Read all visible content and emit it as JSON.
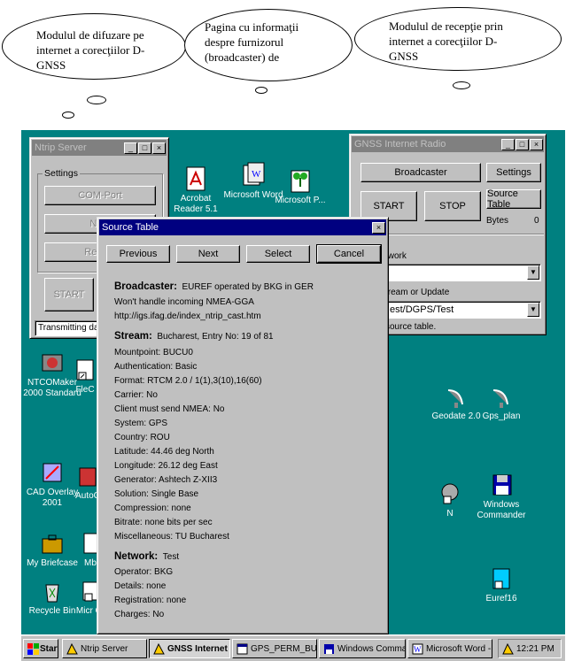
{
  "callouts": {
    "left": "Modulul de difuzare pe internet a corecţiilor D-GNSS",
    "middle": "Pagina cu informaţii despre furnizorul (broadcaster) de",
    "right": "Modulul de recepţie prin internet a corecţiilor D-GNSS"
  },
  "ntrip_server": {
    "title": "Ntrip Server",
    "settings_label": "Settings",
    "com_port": "COM-Port",
    "ntrip": "Ntrip",
    "record": "Record",
    "start": "START",
    "status": "Transmitting data"
  },
  "gnss_radio": {
    "title": "GNSS Internet Radio",
    "broadcaster": "Broadcaster",
    "settings": "Settings",
    "start": "START",
    "stop": "STOP",
    "source_table": "Source Table",
    "bytes_label": "Bytes",
    "bytes_value": "0",
    "network_label": "twork",
    "stream_label": "tream or Update",
    "stream_value": "est/DGPS/Test",
    "status": "source table."
  },
  "source_table": {
    "title": "Source Table",
    "buttons": {
      "previous": "Previous",
      "next": "Next",
      "select": "Select",
      "cancel": "Cancel"
    },
    "broadcaster_hdr": "Broadcaster:",
    "broadcaster_val": "EUREF operated by BKG in GER",
    "broadcaster_note": "Won't handle incoming NMEA-GGA",
    "broadcaster_url": "http://igs.ifag.de/index_ntrip_cast.htm",
    "stream_hdr": "Stream:",
    "stream_val": "Bucharest, Entry No: 19 of 81",
    "stream_rows": [
      "Mountpoint:  BUCU0",
      "Authentication: Basic",
      "Format:    RTCM 2.0 / 1(1),3(10),16(60)",
      "Carrier:    No",
      "Client must send NMEA:    No",
      "System:    GPS",
      "Country:    ROU",
      "Latitude:     44.46 deg North",
      "Longitude:    26.12 deg East",
      "Generator:    Ashtech Z-XII3",
      "Solution:    Single Base",
      "Compression:    none",
      "Bitrate:      none bits per sec",
      "Miscellaneous:    TU Bucharest"
    ],
    "network_hdr": "Network:",
    "network_val": "Test",
    "network_rows": [
      "Operator:  BKG",
      "Details:   none",
      "Registration:   none",
      "Charges:  No"
    ]
  },
  "desktop_icons": {
    "acrobat": "Acrobat Reader 5.1",
    "word": "Microsoft Word",
    "micro": "Microsoft P...",
    "ntcomaker": "NTCOMaker 2000 Standard",
    "flec": "FleC",
    "cad": "CAD Overlay 2001",
    "autoc": "AutoC",
    "briefcase": "My Briefcase",
    "mb": "Mb",
    "recycle": "Recycle Bin",
    "micro2": "Micr Of",
    "geodate": "Geodate 2.0",
    "gps_plan": "Gps_plan",
    "n": "N",
    "windows_commander": "Windows Commander",
    "euref16": "Euref16"
  },
  "taskbar": {
    "start": "Start",
    "items": [
      "Ntrip Server",
      "GNSS Internet ...",
      "GPS_PERM_BUC...",
      "Windows Command...",
      "Microsoft Word - D...",
      "12:21 PM"
    ]
  }
}
